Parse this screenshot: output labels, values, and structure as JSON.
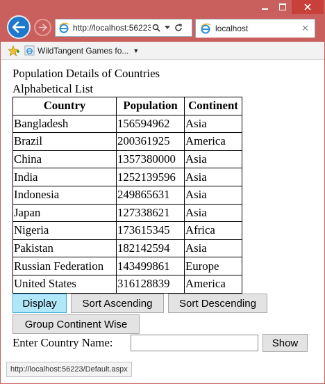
{
  "browser": {
    "address_url": "http://localhost:56223/",
    "tab_title": "localhost",
    "favorites_link": "WildTangent Games fo...",
    "status_url": "http://localhost:56223/Default.aspx"
  },
  "page": {
    "heading": "Population Details of Countries",
    "subheading": "Alphabetical List",
    "table": {
      "headers": [
        "Country",
        "Population",
        "Continent"
      ],
      "rows": [
        [
          "Bangladesh",
          "156594962",
          "Asia"
        ],
        [
          "Brazil",
          "200361925",
          "America"
        ],
        [
          "China",
          "1357380000",
          "Asia"
        ],
        [
          "India",
          "1252139596",
          "Asia"
        ],
        [
          "Indonesia",
          "249865631",
          "Asia"
        ],
        [
          "Japan",
          "127338621",
          "Asia"
        ],
        [
          "Nigeria",
          "173615345",
          "Africa"
        ],
        [
          "Pakistan",
          "182142594",
          "Asia"
        ],
        [
          "Russian Federation",
          "143499861",
          "Europe"
        ],
        [
          "United States",
          "316128839",
          "America"
        ]
      ]
    },
    "buttons": {
      "display": "Display",
      "sort_asc": "Sort Ascending",
      "sort_desc": "Sort Descending",
      "group": "Group Continent Wise",
      "show": "Show"
    },
    "country_label": "Enter Country Name:",
    "country_value": ""
  },
  "colors": {
    "title_bar": "#c9605e",
    "active_button": "#b0e8fa",
    "back_button": "#1d79cc"
  }
}
